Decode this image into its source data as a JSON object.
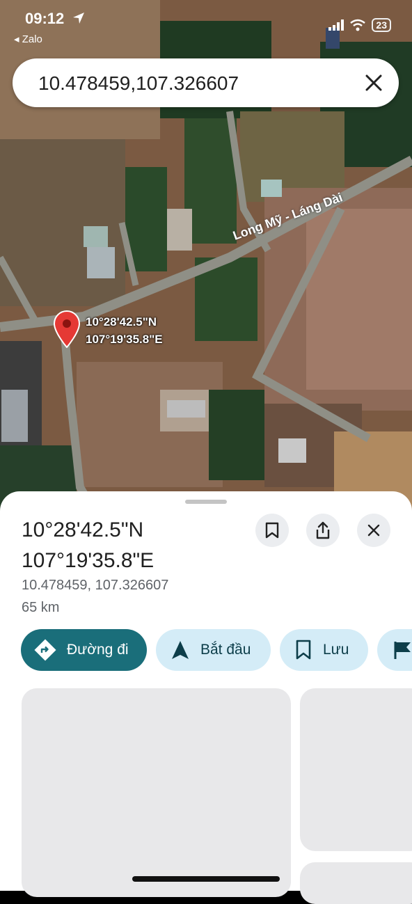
{
  "status_bar": {
    "time": "09:12",
    "back_app": "◂ Zalo",
    "battery": "23"
  },
  "search": {
    "query": "10.478459,107.326607"
  },
  "map": {
    "pin_label": "10°28'42.5\"N\n107°19'35.8\"E",
    "road_label": "Long Mỹ - Láng Dài"
  },
  "place": {
    "title": "10°28'42.5\"N 107°19'35.8\"E",
    "decimal_coords": "10.478459, 107.326607",
    "distance": "65 km"
  },
  "actions": {
    "directions": "Đường đi",
    "start": "Bắt đầu",
    "save": "Lưu"
  },
  "colors": {
    "primary_chip": "#1a6e7a",
    "light_chip": "#d4ecf7",
    "pin": "#e53935"
  }
}
